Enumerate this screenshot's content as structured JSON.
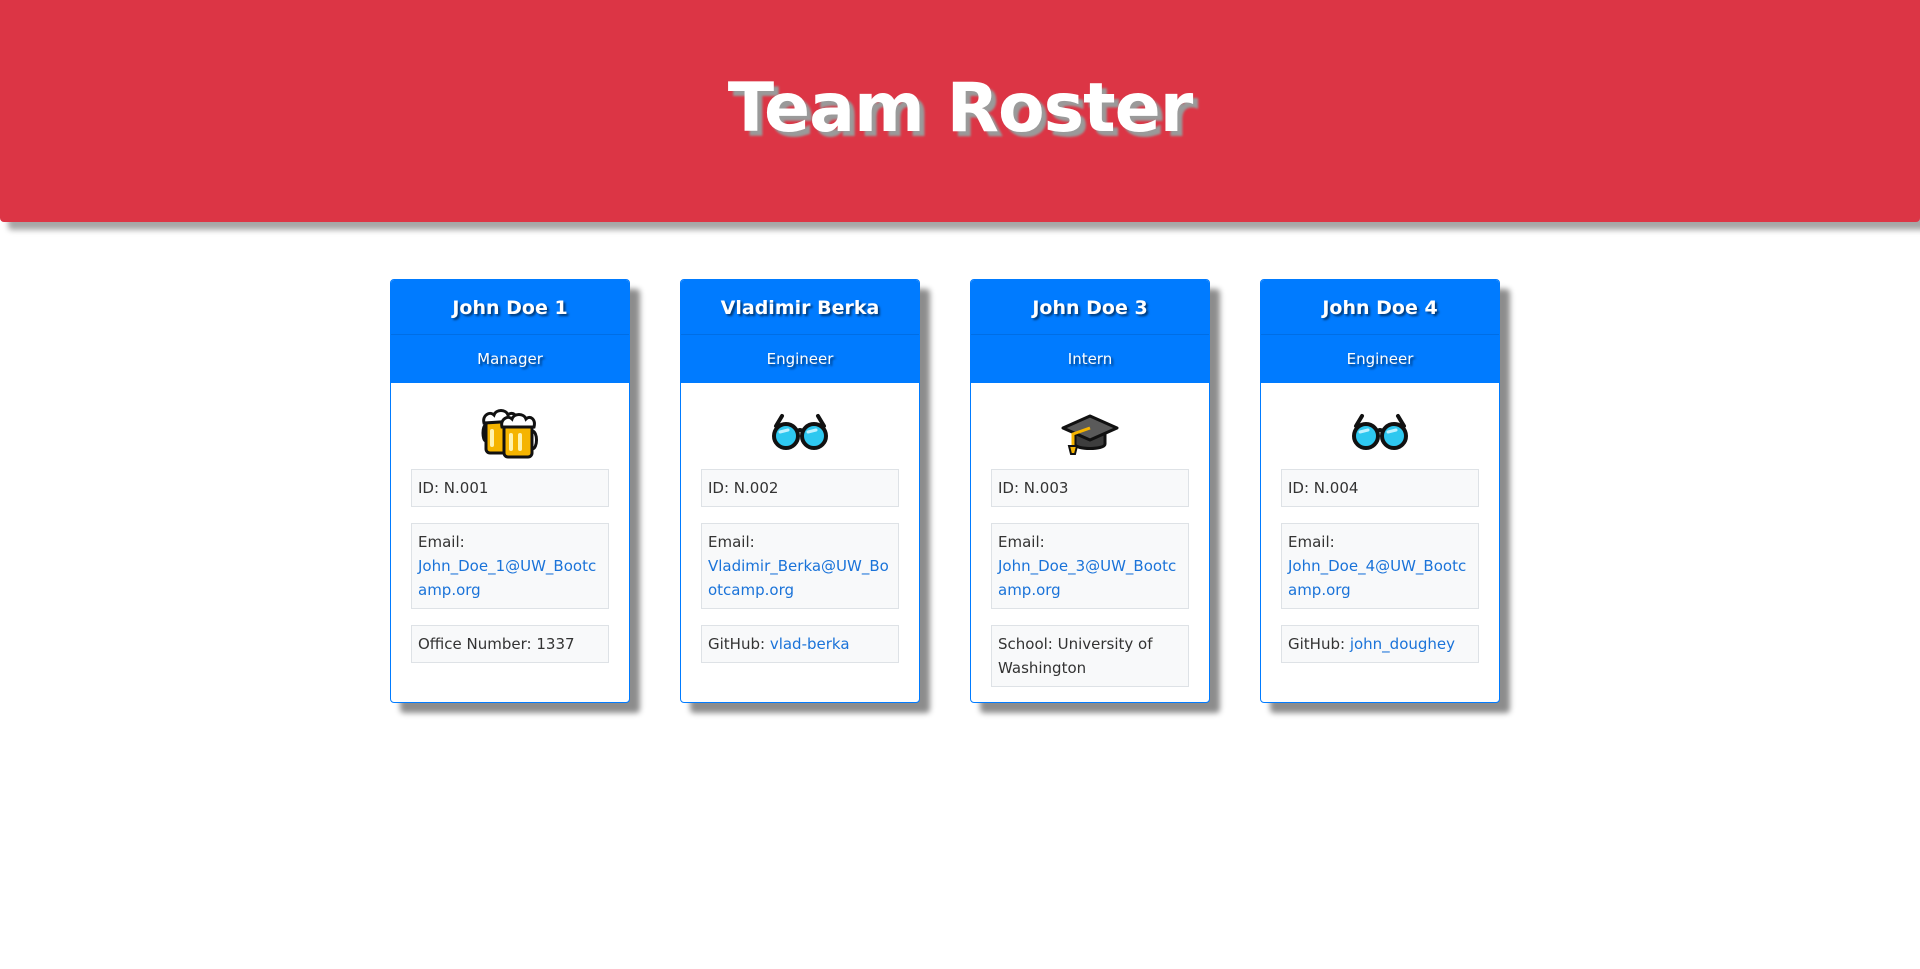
{
  "header": {
    "title": "Team Roster"
  },
  "colors": {
    "header_bg": "#dc3545",
    "card_head_bg": "#007bff",
    "link": "#1a73d9"
  },
  "cards": [
    {
      "name": "John Doe 1",
      "role": "Manager",
      "icon": "beer-mugs-icon",
      "id_text": "ID: N.001",
      "email_label": "Email:",
      "email": "John_Doe_1@UW_Bootcamp.org",
      "extra_label": "Office Number: 1337",
      "extra_value": ""
    },
    {
      "name": "Vladimir Berka",
      "role": "Engineer",
      "icon": "glasses-icon",
      "id_text": "ID: N.002",
      "email_label": "Email:",
      "email": "Vladimir_Berka@UW_Bootcamp.org",
      "extra_label": "GitHub: ",
      "extra_value": "vlad-berka"
    },
    {
      "name": "John Doe 3",
      "role": "Intern",
      "icon": "graduation-cap-icon",
      "id_text": "ID: N.003",
      "email_label": "Email:",
      "email": "John_Doe_3@UW_Bootcamp.org",
      "extra_label": "School: University of Washington",
      "extra_value": ""
    },
    {
      "name": "John Doe 4",
      "role": "Engineer",
      "icon": "glasses-icon",
      "id_text": "ID: N.004",
      "email_label": "Email:",
      "email": "John_Doe_4@UW_Bootcamp.org",
      "extra_label": "GitHub: ",
      "extra_value": "john_doughey"
    }
  ]
}
